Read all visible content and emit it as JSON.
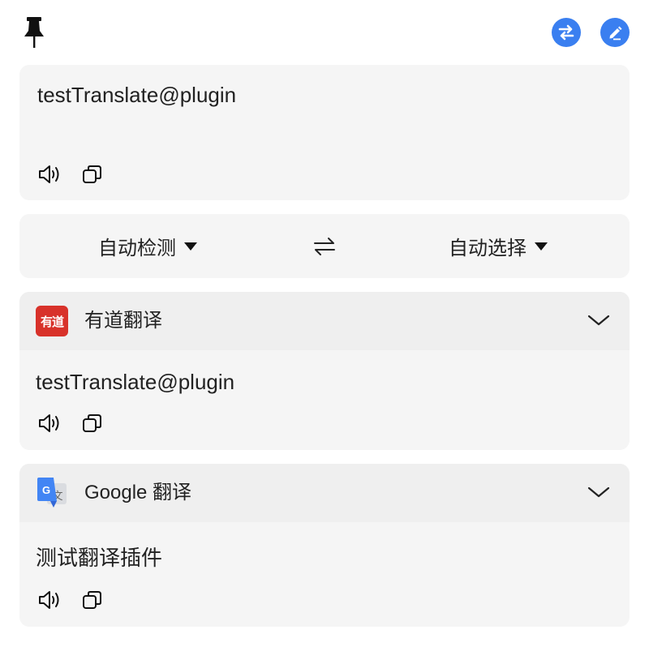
{
  "toolbar": {
    "pin_icon": "pin-icon",
    "swap_button_icon": "swap-icon",
    "edit_button_icon": "pencil-icon",
    "accent": "#3a7ff0"
  },
  "source": {
    "text": "testTranslate@plugin"
  },
  "languages": {
    "from": "自动检测",
    "to": "自动选择"
  },
  "services": [
    {
      "name": "有道翻译",
      "logo_text": "有道",
      "logo_color": "#d8322a",
      "result": "testTranslate@plugin"
    },
    {
      "name": "Google 翻译",
      "logo_text": "G",
      "result": "测试翻译插件"
    }
  ]
}
